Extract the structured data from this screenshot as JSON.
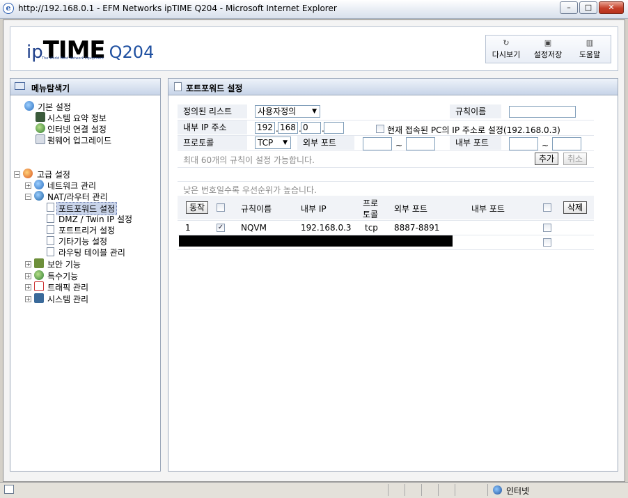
{
  "window": {
    "title": "http://192.168.0.1 - EFM Networks ipTIME Q204 - Microsoft Internet Explorer",
    "min": "–",
    "max": "□",
    "close": "✕"
  },
  "header": {
    "logo_ip": "ip",
    "logo_time": "TIME",
    "logo_model": "Q204",
    "logo_tagline": "The World Best Network Equipment",
    "toolbar": [
      {
        "label": "다시보기",
        "icon": "refresh-icon"
      },
      {
        "label": "설정저장",
        "icon": "save-icon"
      },
      {
        "label": "도움말",
        "icon": "help-book-icon"
      }
    ]
  },
  "menu": {
    "title": "메뉴탐색기",
    "basic": {
      "label": "기본 설정",
      "items": [
        "시스템 요약 정보",
        "인터넷 연결 설정",
        "펌웨어 업그레이드"
      ]
    },
    "advanced": {
      "label": "고급 설정",
      "network": "네트워크 관리",
      "nat": "NAT/라우터 관리",
      "nat_items": [
        "포트포워드 설정",
        "DMZ / Twin IP 설정",
        "포트트리거 설정",
        "기타기능 설정",
        "라우팅 테이블 관리"
      ],
      "others": [
        "보안 기능",
        "특수기능",
        "트래픽 관리",
        "시스템 관리"
      ]
    }
  },
  "panel": {
    "title": "포트포워드 설정",
    "form": {
      "list_label": "정의된 리스트",
      "list_value": "사용자정의",
      "rule_name_label": "규칙이름",
      "rule_name_value": "",
      "inner_ip_label": "내부 IP 주소",
      "ip": [
        "192",
        "168",
        "0",
        ""
      ],
      "current_pc_label": "현재 접속된 PC의 IP 주소로 설정(192.168.0.3)",
      "protocol_label": "프로토콜",
      "protocol_value": "TCP",
      "ext_port_label": "외부 포트",
      "int_port_label": "내부 포트",
      "tilde": "~",
      "max_rules_note": "최대 60개의 규칙이 설정 가능합니다.",
      "add_btn": "추가",
      "cancel_btn": "취소"
    },
    "priority_note": "낮은 번호일수록 우선순위가 높습니다.",
    "table": {
      "action_btn": "동작",
      "col_rule": "규칙이름",
      "col_inner_ip": "내부 IP",
      "col_protocol_1": "프로",
      "col_protocol_2": "토콜",
      "col_ext_port": "외부 포트",
      "col_int_port": "내부 포트",
      "delete_btn": "삭제",
      "rows": [
        {
          "no": "1",
          "checked": "✓",
          "name": "NQVM",
          "ip": "192.168.0.3",
          "proto": "tcp",
          "ext": "8887-8891",
          "int": ""
        }
      ]
    }
  },
  "status": {
    "zone": "인터넷"
  }
}
